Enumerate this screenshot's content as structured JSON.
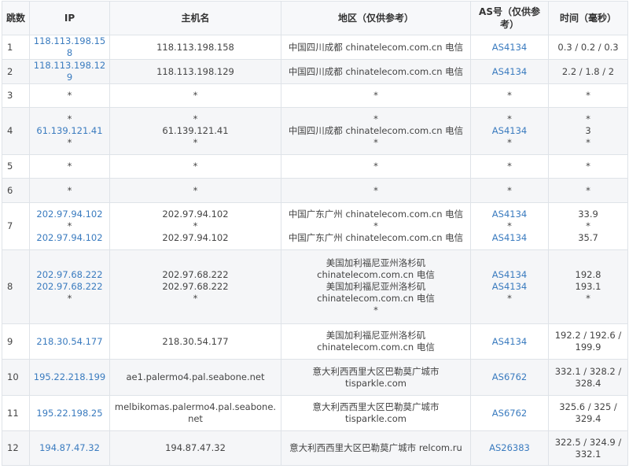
{
  "headers": {
    "hop": "跳数",
    "ip": "IP",
    "host": "主机名",
    "region": "地区（仅供参考）",
    "as": "AS号（仅供参考）",
    "time": "时间（毫秒）"
  },
  "rows": [
    {
      "hop": "1",
      "ip": [
        "118.113.198.158"
      ],
      "host": [
        "118.113.198.158"
      ],
      "region": [
        "中国四川成都 chinatelecom.com.cn 电信"
      ],
      "as": [
        "AS4134"
      ],
      "time": [
        "0.3 / 0.2 / 0.3"
      ]
    },
    {
      "hop": "2",
      "ip": [
        "118.113.198.129"
      ],
      "host": [
        "118.113.198.129"
      ],
      "region": [
        "中国四川成都 chinatelecom.com.cn 电信"
      ],
      "as": [
        "AS4134"
      ],
      "time": [
        "2.2 / 1.8 / 2"
      ]
    },
    {
      "hop": "3",
      "ip": [
        "*"
      ],
      "host": [
        "*"
      ],
      "region": [
        "*"
      ],
      "as": [
        "*"
      ],
      "time": [
        "*"
      ]
    },
    {
      "hop": "4",
      "ip": [
        "*",
        "61.139.121.41",
        "*"
      ],
      "host": [
        "*",
        "61.139.121.41",
        "*"
      ],
      "region": [
        "*",
        "中国四川成都 chinatelecom.com.cn 电信",
        "*"
      ],
      "as": [
        "*",
        "AS4134",
        "*"
      ],
      "time": [
        "*",
        "3",
        "*"
      ]
    },
    {
      "hop": "5",
      "ip": [
        "*"
      ],
      "host": [
        "*"
      ],
      "region": [
        "*"
      ],
      "as": [
        "*"
      ],
      "time": [
        "*"
      ]
    },
    {
      "hop": "6",
      "ip": [
        "*"
      ],
      "host": [
        "*"
      ],
      "region": [
        "*"
      ],
      "as": [
        "*"
      ],
      "time": [
        "*"
      ]
    },
    {
      "hop": "7",
      "ip": [
        "202.97.94.102",
        "*",
        "202.97.94.102"
      ],
      "host": [
        "202.97.94.102",
        "*",
        "202.97.94.102"
      ],
      "region": [
        "中国广东广州 chinatelecom.com.cn 电信",
        "*",
        "中国广东广州 chinatelecom.com.cn 电信"
      ],
      "as": [
        "AS4134",
        "*",
        "AS4134"
      ],
      "time": [
        "33.9",
        "*",
        "35.7"
      ]
    },
    {
      "hop": "8",
      "ip": [
        "202.97.68.222",
        "202.97.68.222",
        "*"
      ],
      "host": [
        "202.97.68.222",
        "202.97.68.222",
        "*"
      ],
      "region": [
        "美国加利福尼亚州洛杉矶",
        "chinatelecom.com.cn 电信",
        "美国加利福尼亚州洛杉矶",
        "chinatelecom.com.cn 电信",
        "*"
      ],
      "as": [
        "AS4134",
        "AS4134",
        "*"
      ],
      "time": [
        "192.8",
        "193.1",
        "*"
      ]
    },
    {
      "hop": "9",
      "ip": [
        "218.30.54.177"
      ],
      "host": [
        "218.30.54.177"
      ],
      "region": [
        "美国加利福尼亚州洛杉矶",
        "chinatelecom.com.cn 电信"
      ],
      "as": [
        "AS4134"
      ],
      "time": [
        "192.2 / 192.6 /",
        "199.9"
      ]
    },
    {
      "hop": "10",
      "ip": [
        "195.22.218.199"
      ],
      "host": [
        "ae1.palermo4.pal.seabone.net"
      ],
      "region": [
        "意大利西西里大区巴勒莫广城市",
        "tisparkle.com"
      ],
      "as": [
        "AS6762"
      ],
      "time": [
        "332.1 / 328.2 /",
        "328.4"
      ]
    },
    {
      "hop": "11",
      "ip": [
        "195.22.198.25"
      ],
      "host": [
        "melbikomas.palermo4.pal.seabone.net"
      ],
      "region": [
        "意大利西西里大区巴勒莫广城市",
        "tisparkle.com"
      ],
      "as": [
        "AS6762"
      ],
      "time": [
        "325.6 / 325 /",
        "329.4"
      ]
    },
    {
      "hop": "12",
      "ip": [
        "194.87.47.32"
      ],
      "host": [
        "194.87.47.32"
      ],
      "region": [
        "意大利西西里大区巴勒莫广城市 relcom.ru"
      ],
      "as": [
        "AS26383"
      ],
      "time": [
        "322.5 / 324.9 /",
        "332.1"
      ]
    }
  ]
}
